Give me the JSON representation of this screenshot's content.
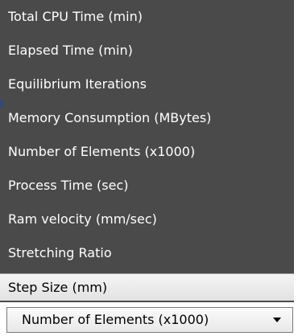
{
  "dropdown": {
    "items": [
      {
        "label": "Total CPU Time (min)"
      },
      {
        "label": "Elapsed Time (min)"
      },
      {
        "label": "Equilibrium Iterations"
      },
      {
        "label": "Memory Consumption (MBytes)"
      },
      {
        "label": "Number of Elements (x1000)"
      },
      {
        "label": "Process Time (sec)"
      },
      {
        "label": "Ram velocity (mm/sec)"
      },
      {
        "label": "Stretching Ratio"
      },
      {
        "label": "Step Size (mm)"
      }
    ],
    "highlighted_item": "Step Size (mm)"
  },
  "combo": {
    "selected_value": "Number of Elements (x1000)",
    "arrow_icon": "chevron-down-icon"
  },
  "colors": {
    "list_background": "#4a4a4a",
    "list_text": "#ffffff",
    "highlight_background": "#ececec"
  }
}
